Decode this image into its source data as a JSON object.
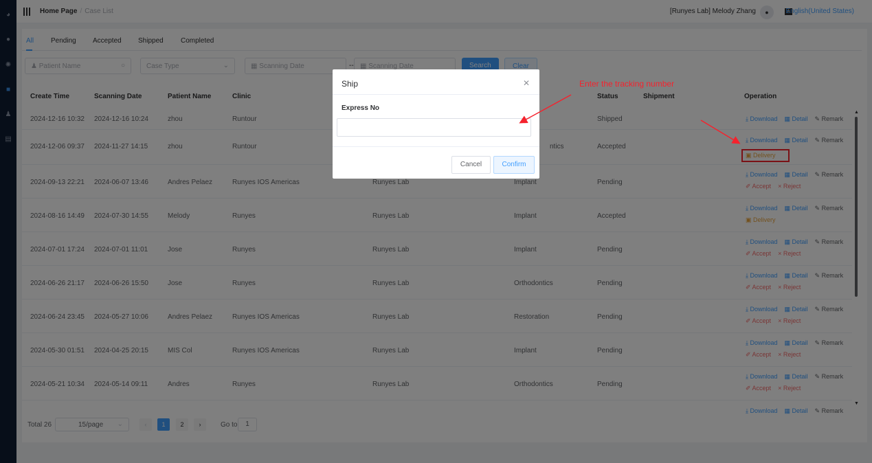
{
  "colors": {
    "accent": "#409eff",
    "danger": "#f56c6c",
    "warning": "#e6a23c",
    "annotation": "#f5222d"
  },
  "sidebar": {
    "icons": [
      "dashboard-icon",
      "user-icon",
      "settings-icon",
      "grid-icon",
      "team-icon",
      "document-icon"
    ]
  },
  "header": {
    "breadcrumb_home": "Home Page",
    "breadcrumb_separator": "/",
    "breadcrumb_current": "Case List",
    "user": "[Runyes Lab] Melody Zhang",
    "language": "English(United States)"
  },
  "tabs": [
    "All",
    "Pending",
    "Accepted",
    "Shipped",
    "Completed"
  ],
  "filters": {
    "patient_name_placeholder": "Patient Name",
    "case_type_placeholder": "Case Type",
    "scan_start_placeholder": "Scanning Date",
    "range_separator": "--",
    "scan_end_placeholder": "Scanning Date",
    "search_label": "Search",
    "clear_label": "Clear"
  },
  "table": {
    "columns": [
      "Create Time",
      "Scanning Date",
      "Patient Name",
      "Clinic",
      "Status",
      "Shipment",
      "Operation"
    ],
    "rows": [
      {
        "create": "2024-12-16 10:32",
        "scan": "2024-12-16 10:24",
        "patient": "zhou",
        "clinic": "Runtour",
        "lab": "",
        "type": "",
        "status": "Shipped"
      },
      {
        "create": "2024-12-06 09:37",
        "scan": "2024-11-27 14:15",
        "patient": "zhou",
        "clinic": "Runtour",
        "lab": "",
        "type": "ntics",
        "status": "Accepted"
      },
      {
        "create": "2024-09-13 22:21",
        "scan": "2024-06-07 13:46",
        "patient": "Andres Pelaez",
        "clinic": "Runyes IOS Americas",
        "lab": "Runyes Lab",
        "type": "Implant",
        "status": "Pending"
      },
      {
        "create": "2024-08-16 14:49",
        "scan": "2024-07-30 14:55",
        "patient": "Melody",
        "clinic": "Runyes",
        "lab": "Runyes Lab",
        "type": "Implant",
        "status": "Accepted"
      },
      {
        "create": "2024-07-01 17:24",
        "scan": "2024-07-01 11:01",
        "patient": "Jose",
        "clinic": "Runyes",
        "lab": "Runyes Lab",
        "type": "Implant",
        "status": "Pending"
      },
      {
        "create": "2024-06-26 21:17",
        "scan": "2024-06-26 15:50",
        "patient": "Jose",
        "clinic": "Runyes",
        "lab": "Runyes Lab",
        "type": "Orthodontics",
        "status": "Pending"
      },
      {
        "create": "2024-06-24 23:45",
        "scan": "2024-05-27 10:06",
        "patient": "Andres Pelaez",
        "clinic": "Runyes IOS Americas",
        "lab": "Runyes Lab",
        "type": "Restoration",
        "status": "Pending"
      },
      {
        "create": "2024-05-30 01:51",
        "scan": "2024-04-25 20:15",
        "patient": "MIS Col",
        "clinic": "Runyes IOS Americas",
        "lab": "Runyes Lab",
        "type": "Implant",
        "status": "Pending"
      },
      {
        "create": "2024-05-21 10:34",
        "scan": "2024-05-14 09:11",
        "patient": "Andres",
        "clinic": "Runyes",
        "lab": "Runyes Lab",
        "type": "Orthodontics",
        "status": "Pending"
      }
    ],
    "ops": {
      "download": "Download",
      "detail": "Detail",
      "remark": "Remark",
      "delivery": "Delivery",
      "accept": "Accept",
      "reject": "Reject"
    }
  },
  "pagination": {
    "total": "Total 26",
    "page_size": "15/page",
    "pages": [
      "1",
      "2"
    ],
    "current": "1",
    "goto_label": "Go to",
    "goto_value": "1"
  },
  "dialog": {
    "title": "Ship",
    "field_label": "Express No",
    "field_value": "",
    "cancel": "Cancel",
    "confirm": "Confirm"
  },
  "annotation": {
    "text": "Enter the tracking number"
  }
}
